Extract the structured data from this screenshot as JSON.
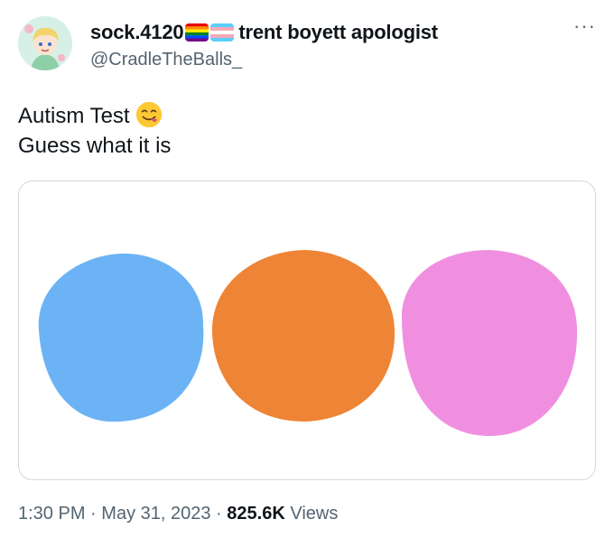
{
  "tweet": {
    "display_name": "sock.4120",
    "display_name_suffix": "trent boyett apologist",
    "handle": "@CradleTheBalls_",
    "text_line1": "Autism Test",
    "text_line2": "Guess what it is",
    "emoji": "face-savoring-food-emoji",
    "blob_colors": [
      "#6cb3f5",
      "#ee8435",
      "#f08fe0"
    ],
    "time": "1:30 PM",
    "separator": "·",
    "date": "May 31, 2023",
    "views_count": "825.6K",
    "views_label": "Views"
  },
  "icons": {
    "more": "more-options-icon",
    "flags": [
      "rainbow-pride-flag-icon",
      "transgender-flag-icon"
    ]
  }
}
